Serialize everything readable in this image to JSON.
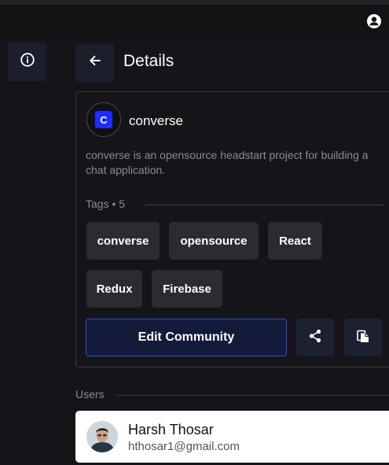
{
  "header": {
    "user_icon": "account-circle-icon"
  },
  "sidebar": {
    "info_icon": "info-icon"
  },
  "details": {
    "back_icon": "arrow-left-icon",
    "title": "Details"
  },
  "community": {
    "avatar_letter": "C",
    "avatar_color": "#1d2dff",
    "name": "converse",
    "description": "converse is an opensource headstart project for building a chat application.",
    "tags_label": "Tags • 5",
    "tags": [
      "converse",
      "opensource",
      "React",
      "Redux",
      "Firebase"
    ],
    "edit_button_label": "Edit Community",
    "share_icon": "share-icon",
    "copy_icon": "copy-icon"
  },
  "users": {
    "section_label": "Users",
    "list": [
      {
        "name": "Harsh Thosar",
        "email": "hthosar1@gmail.com"
      }
    ]
  },
  "colors": {
    "background": "#151519",
    "accent": "#2a49d8",
    "tag_background": "#2b2b30"
  }
}
